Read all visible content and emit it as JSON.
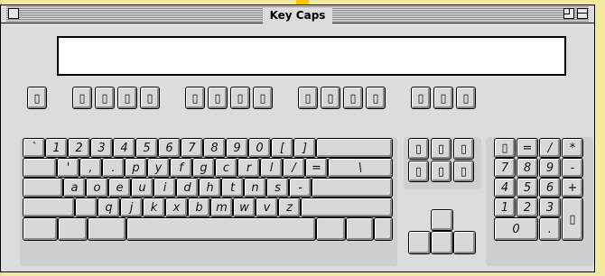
{
  "window": {
    "title": "Key Caps"
  },
  "display": {
    "text": ""
  },
  "box_glyph": "▯",
  "function_row": [
    "▯",
    "▯",
    "▯",
    "▯",
    "▯",
    "▯",
    "▯",
    "▯",
    "▯",
    "▯",
    "▯",
    "▯",
    "▯",
    "▯",
    "▯",
    "▯"
  ],
  "main_rows": [
    [
      "`",
      "1",
      "2",
      "3",
      "4",
      "5",
      "6",
      "7",
      "8",
      "9",
      "0",
      "[",
      "]",
      ""
    ],
    [
      "",
      "'",
      ",",
      ".",
      "p",
      "y",
      "f",
      "g",
      "c",
      "r",
      "l",
      "/",
      "=",
      "\\"
    ],
    [
      "",
      "a",
      "o",
      "e",
      "u",
      "i",
      "d",
      "h",
      "t",
      "n",
      "s",
      "-",
      ""
    ],
    [
      "",
      "",
      "q",
      "j",
      "k",
      "x",
      "b",
      "m",
      "w",
      "v",
      "z",
      ""
    ],
    [
      "",
      "",
      "",
      "",
      "",
      "",
      ""
    ]
  ],
  "nav_cluster": [
    "▯",
    "▯",
    "▯",
    "▯",
    "▯",
    "▯"
  ],
  "arrow_keys": [
    "",
    "",
    "",
    ""
  ],
  "keypad": {
    "row1": [
      "▯",
      "=",
      "/",
      "*"
    ],
    "row2": [
      "7",
      "8",
      "9",
      "-"
    ],
    "row3": [
      "4",
      "5",
      "6",
      "+"
    ],
    "row4": [
      "1",
      "2",
      "3"
    ],
    "row5": [
      "0",
      "."
    ],
    "enter": "▯"
  }
}
